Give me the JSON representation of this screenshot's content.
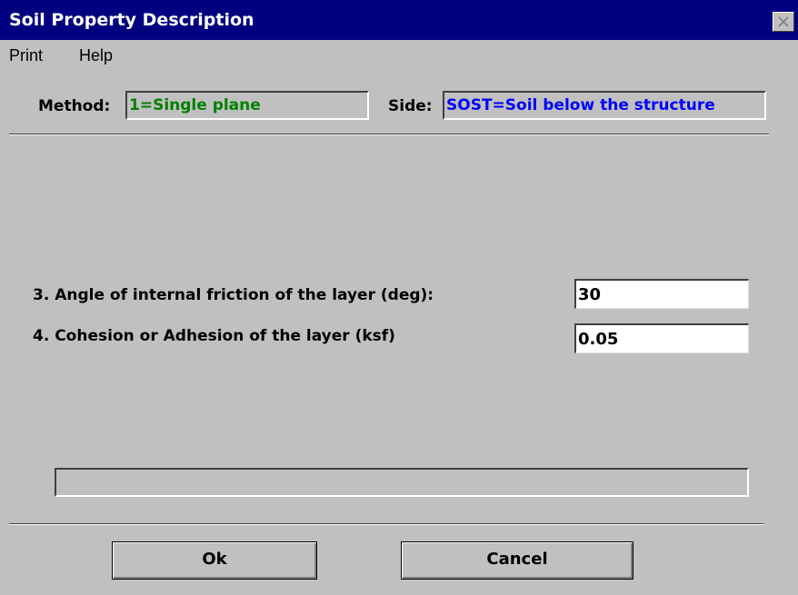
{
  "window": {
    "title": "Soil Property Description"
  },
  "menu": {
    "items": [
      "Print",
      "Help"
    ]
  },
  "header": {
    "method_label": "Method:",
    "method_value": "1=Single plane",
    "method_color": "#008000",
    "side_label": "Side:",
    "side_value": "SOST=Soil below the structure",
    "side_color": "#0000ff"
  },
  "fields": [
    {
      "label": "3. Angle of internal friction of the layer (deg):",
      "value": "30"
    },
    {
      "label": "4. Cohesion or Adhesion of the layer (ksf)",
      "value": "0.05"
    }
  ],
  "progress": {
    "fraction": 0
  },
  "buttons": {
    "ok_label": "Ok",
    "cancel_label": "Cancel"
  },
  "icons": {
    "close": "close-icon"
  },
  "colors": {
    "titlebar": "#000080",
    "face": "#c0c0c0"
  }
}
